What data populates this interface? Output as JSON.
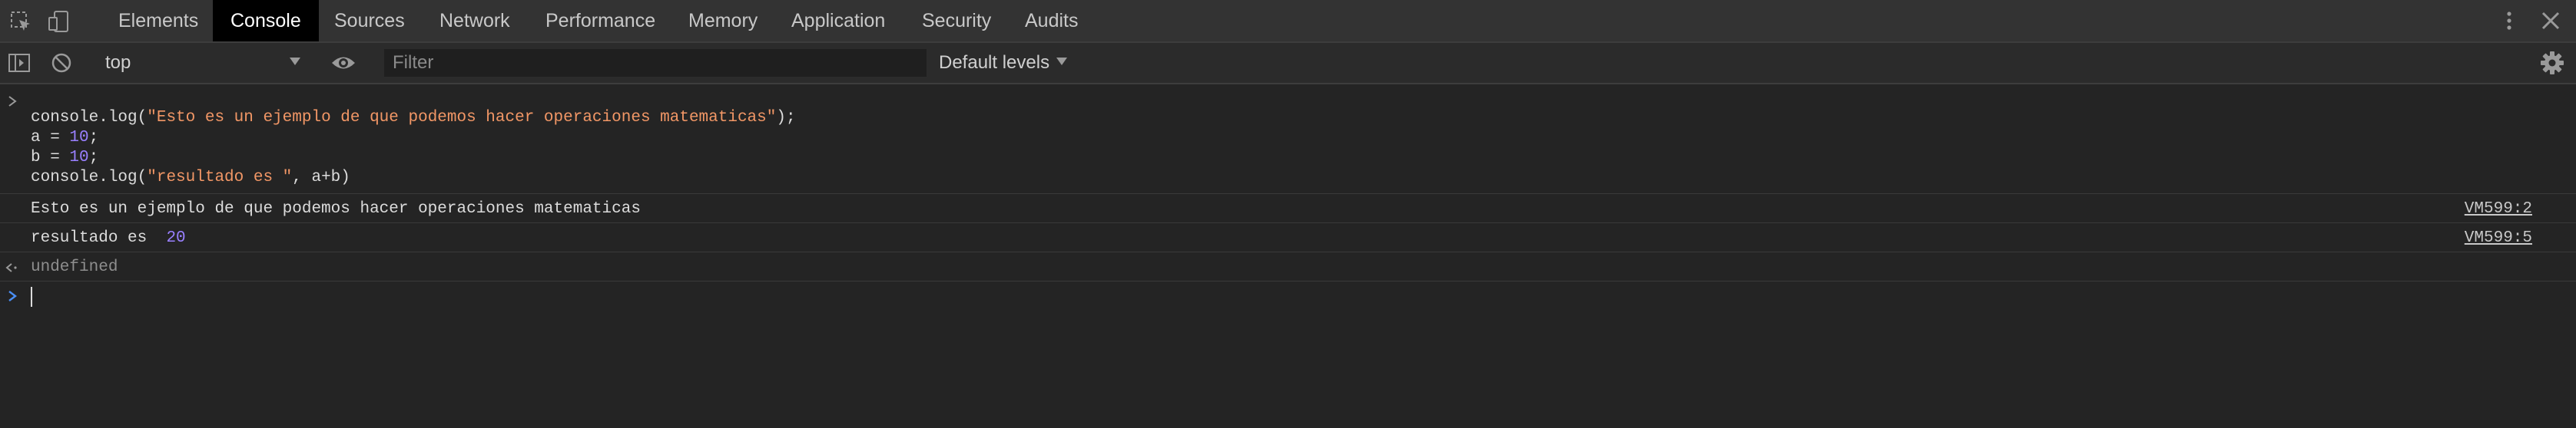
{
  "toolbar_tabs": [
    "Elements",
    "Console",
    "Sources",
    "Network",
    "Performance",
    "Memory",
    "Application",
    "Security",
    "Audits"
  ],
  "active_tab": "Console",
  "icons": {
    "inspect": "inspect-element-icon",
    "device": "device-toolbar-icon",
    "more": "kebab-menu-icon",
    "close": "close-icon",
    "sidebar": "sidebar-toggle-icon",
    "clear": "clear-console-icon",
    "eye": "live-expression-icon",
    "settings": "gear-icon"
  },
  "console_toolbar": {
    "context": "top",
    "filter_placeholder": "Filter",
    "levels": "Default levels"
  },
  "entries": {
    "input": {
      "line1_fn": "console.log(",
      "line1_str": "\"Esto es un ejemplo de que podemos hacer operaciones matematicas\"",
      "line1_end": ");",
      "line2_a": "a = ",
      "line2_num": "10",
      "line2_end": ";",
      "line3_a": "b = ",
      "line3_num": "10",
      "line3_end": ";",
      "line4_fn": "console.log(",
      "line4_str": "\"resultado es \"",
      "line4_end": ", a+b)"
    },
    "log1": {
      "text": "Esto es un ejemplo de que podemos hacer operaciones matematicas",
      "source": "VM599:2"
    },
    "log2": {
      "text": "resultado es ",
      "value": "20",
      "source": "VM599:5"
    },
    "result": {
      "text": "undefined"
    }
  },
  "colors": {
    "panel_bg": "#242424",
    "tabbar_bg": "#333333",
    "string": "#f29766",
    "number": "#9980ff",
    "prompt_blue": "#4a8ff5"
  }
}
